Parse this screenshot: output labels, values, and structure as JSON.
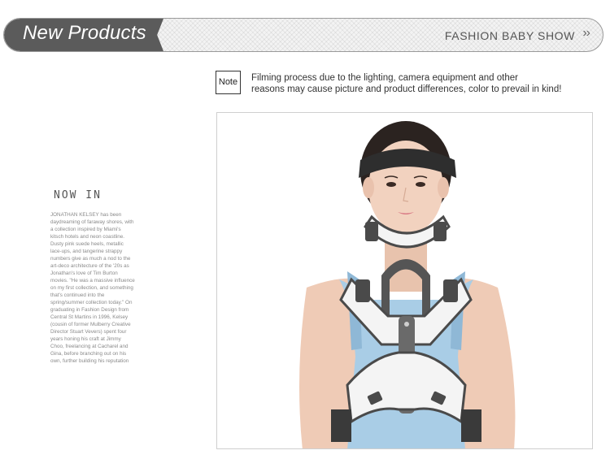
{
  "banner": {
    "title": "New Products",
    "link_label": "FASHION BABY SHOW",
    "chevron": "››"
  },
  "note": {
    "label": "Note",
    "lines": [
      "Filming process due to the lighting, camera equipment and other",
      "reasons may cause picture and product differences, color to prevail in kind!"
    ]
  },
  "magazine": {
    "heading": "NOW IN",
    "lines": [
      "JONATHAN KELSEY has been",
      "daydreaming of faraway shores, with",
      "a collection inspired by Miami's",
      "kitsch hotels and neon coastline.",
      "Dusty pink suede heels, metallic",
      "lace-ups, and tangerine strappy",
      "numbers give as much a nod to the",
      "art-deco architecture of the '20s as",
      "Jonathan's love of Tim Burton",
      "movies. \"He was a massive influence",
      "on my first collection, and something",
      "that's continued into the",
      "spring/summer collection today.\" On",
      "graduating in Fashion Design from",
      "Central St Martins in 1996, Kelsey",
      "(cousin of former Mulberry Creative",
      "Director Stuart Vevers) spent four",
      "years honing his craft at Jimmy",
      "Choo, freelancing at Cacharel and",
      "Gina, before branching out on his",
      "own, further building his reputation"
    ]
  },
  "photo": {
    "subject": "woman wearing cervical thoracic neck brace",
    "colors": {
      "brace_white": "#f4f4f4",
      "brace_dark": "#4a4a4a",
      "tank_top": "#a9cde6",
      "skin": "#f2d2bf",
      "hair": "#2b2320"
    }
  }
}
